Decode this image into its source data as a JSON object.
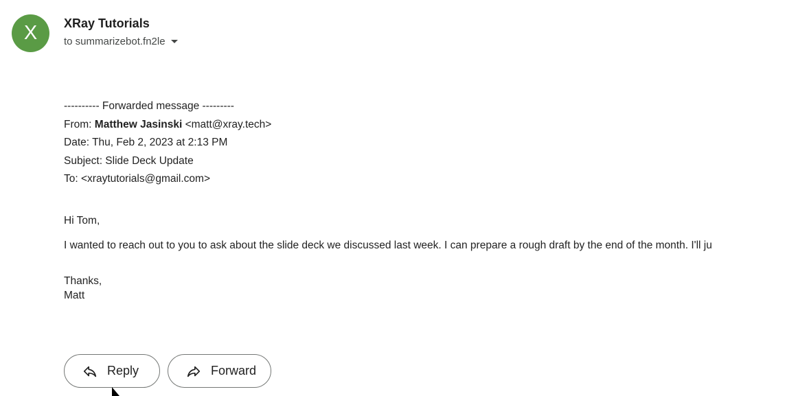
{
  "sender": {
    "avatar_letter": "X",
    "avatar_color": "#5a9b45",
    "name": "XRay Tutorials",
    "recipient": "to summarizebot.fn2le",
    "recipient_dropdown_icon": "caret-down-icon"
  },
  "message": {
    "forward_header": "---------- Forwarded message ---------",
    "from_label": "From: ",
    "from_name": "Matthew Jasinski",
    "from_email": " <matt@xray.tech>",
    "date": "Date: Thu, Feb 2, 2023 at 2:13 PM",
    "subject": "Subject: Slide Deck Update",
    "to": "To: <xraytutorials@gmail.com>",
    "greeting": "Hi Tom,",
    "paragraph": "I wanted to reach out to you to ask about the slide deck we discussed last week. I can prepare a rough draft by the end of the month. I'll ju",
    "signoff": "Thanks,",
    "signature": "Matt"
  },
  "actions": {
    "reply_label": "Reply",
    "reply_icon": "reply-arrow-icon",
    "forward_label": "Forward",
    "forward_icon": "forward-arrow-icon"
  },
  "colors": {
    "button_border": "#747775",
    "text": "#222222"
  }
}
